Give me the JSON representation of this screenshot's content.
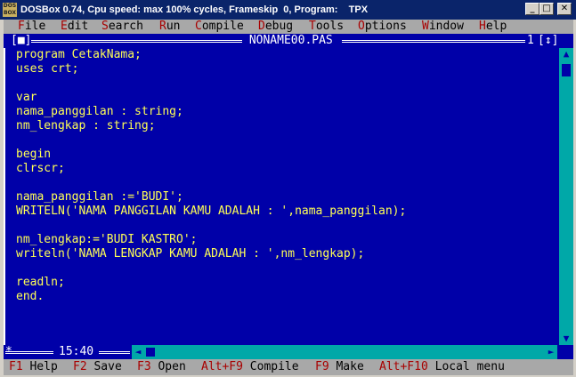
{
  "window": {
    "icon_text": "DOS BOX",
    "title": "DOSBox 0.74, Cpu speed: max 100% cycles, Frameskip  0, Program:    TPX",
    "minimize_glyph": "_",
    "maximize_glyph": "□",
    "close_glyph": "✕"
  },
  "menu": [
    {
      "hot": "F",
      "rest": "ile"
    },
    {
      "hot": "E",
      "rest": "dit"
    },
    {
      "hot": "S",
      "rest": "earch"
    },
    {
      "hot": "R",
      "rest": "un"
    },
    {
      "hot": "C",
      "rest": "ompile"
    },
    {
      "hot": "D",
      "rest": "ebug"
    },
    {
      "hot": "T",
      "rest": "ools"
    },
    {
      "hot": "O",
      "rest": "ptions"
    },
    {
      "hot": "W",
      "rest": "indow"
    },
    {
      "hot": "H",
      "rest": "elp"
    }
  ],
  "editor": {
    "file_name": " NONAME00.PAS ",
    "close_box": "[■]",
    "window_number": "1",
    "zoom_box": "[↕]",
    "cursor_position": "15:40",
    "lines": [
      "program CetakNama;",
      "uses crt;",
      "",
      "var",
      "nama_panggilan : string;",
      "nm_lengkap : string;",
      "",
      "begin",
      "clrscr;",
      "",
      "nama_panggilan :='BUDI';",
      "WRITELN('NAMA PANGGILAN KAMU ADALAH : ',nama_panggilan);",
      "",
      "nm_lengkap:='BUDI KASTRO';",
      "writeln('NAMA LENGKAP KAMU ADALAH : ',nm_lengkap);",
      "",
      "readln;",
      "end."
    ]
  },
  "status": [
    {
      "key": "F1",
      "label": "Help"
    },
    {
      "key": "F2",
      "label": "Save"
    },
    {
      "key": "F3",
      "label": "Open"
    },
    {
      "key": "Alt+F9",
      "label": "Compile"
    },
    {
      "key": "F9",
      "label": "Make"
    },
    {
      "key": "Alt+F10",
      "label": "Local menu"
    }
  ],
  "colors": {
    "editor_background": "#0000a8",
    "code_text": "#ffff55",
    "menu_background": "#a8a8a8",
    "hotkey": "#a80000",
    "scrollbar": "#00a8a8"
  }
}
